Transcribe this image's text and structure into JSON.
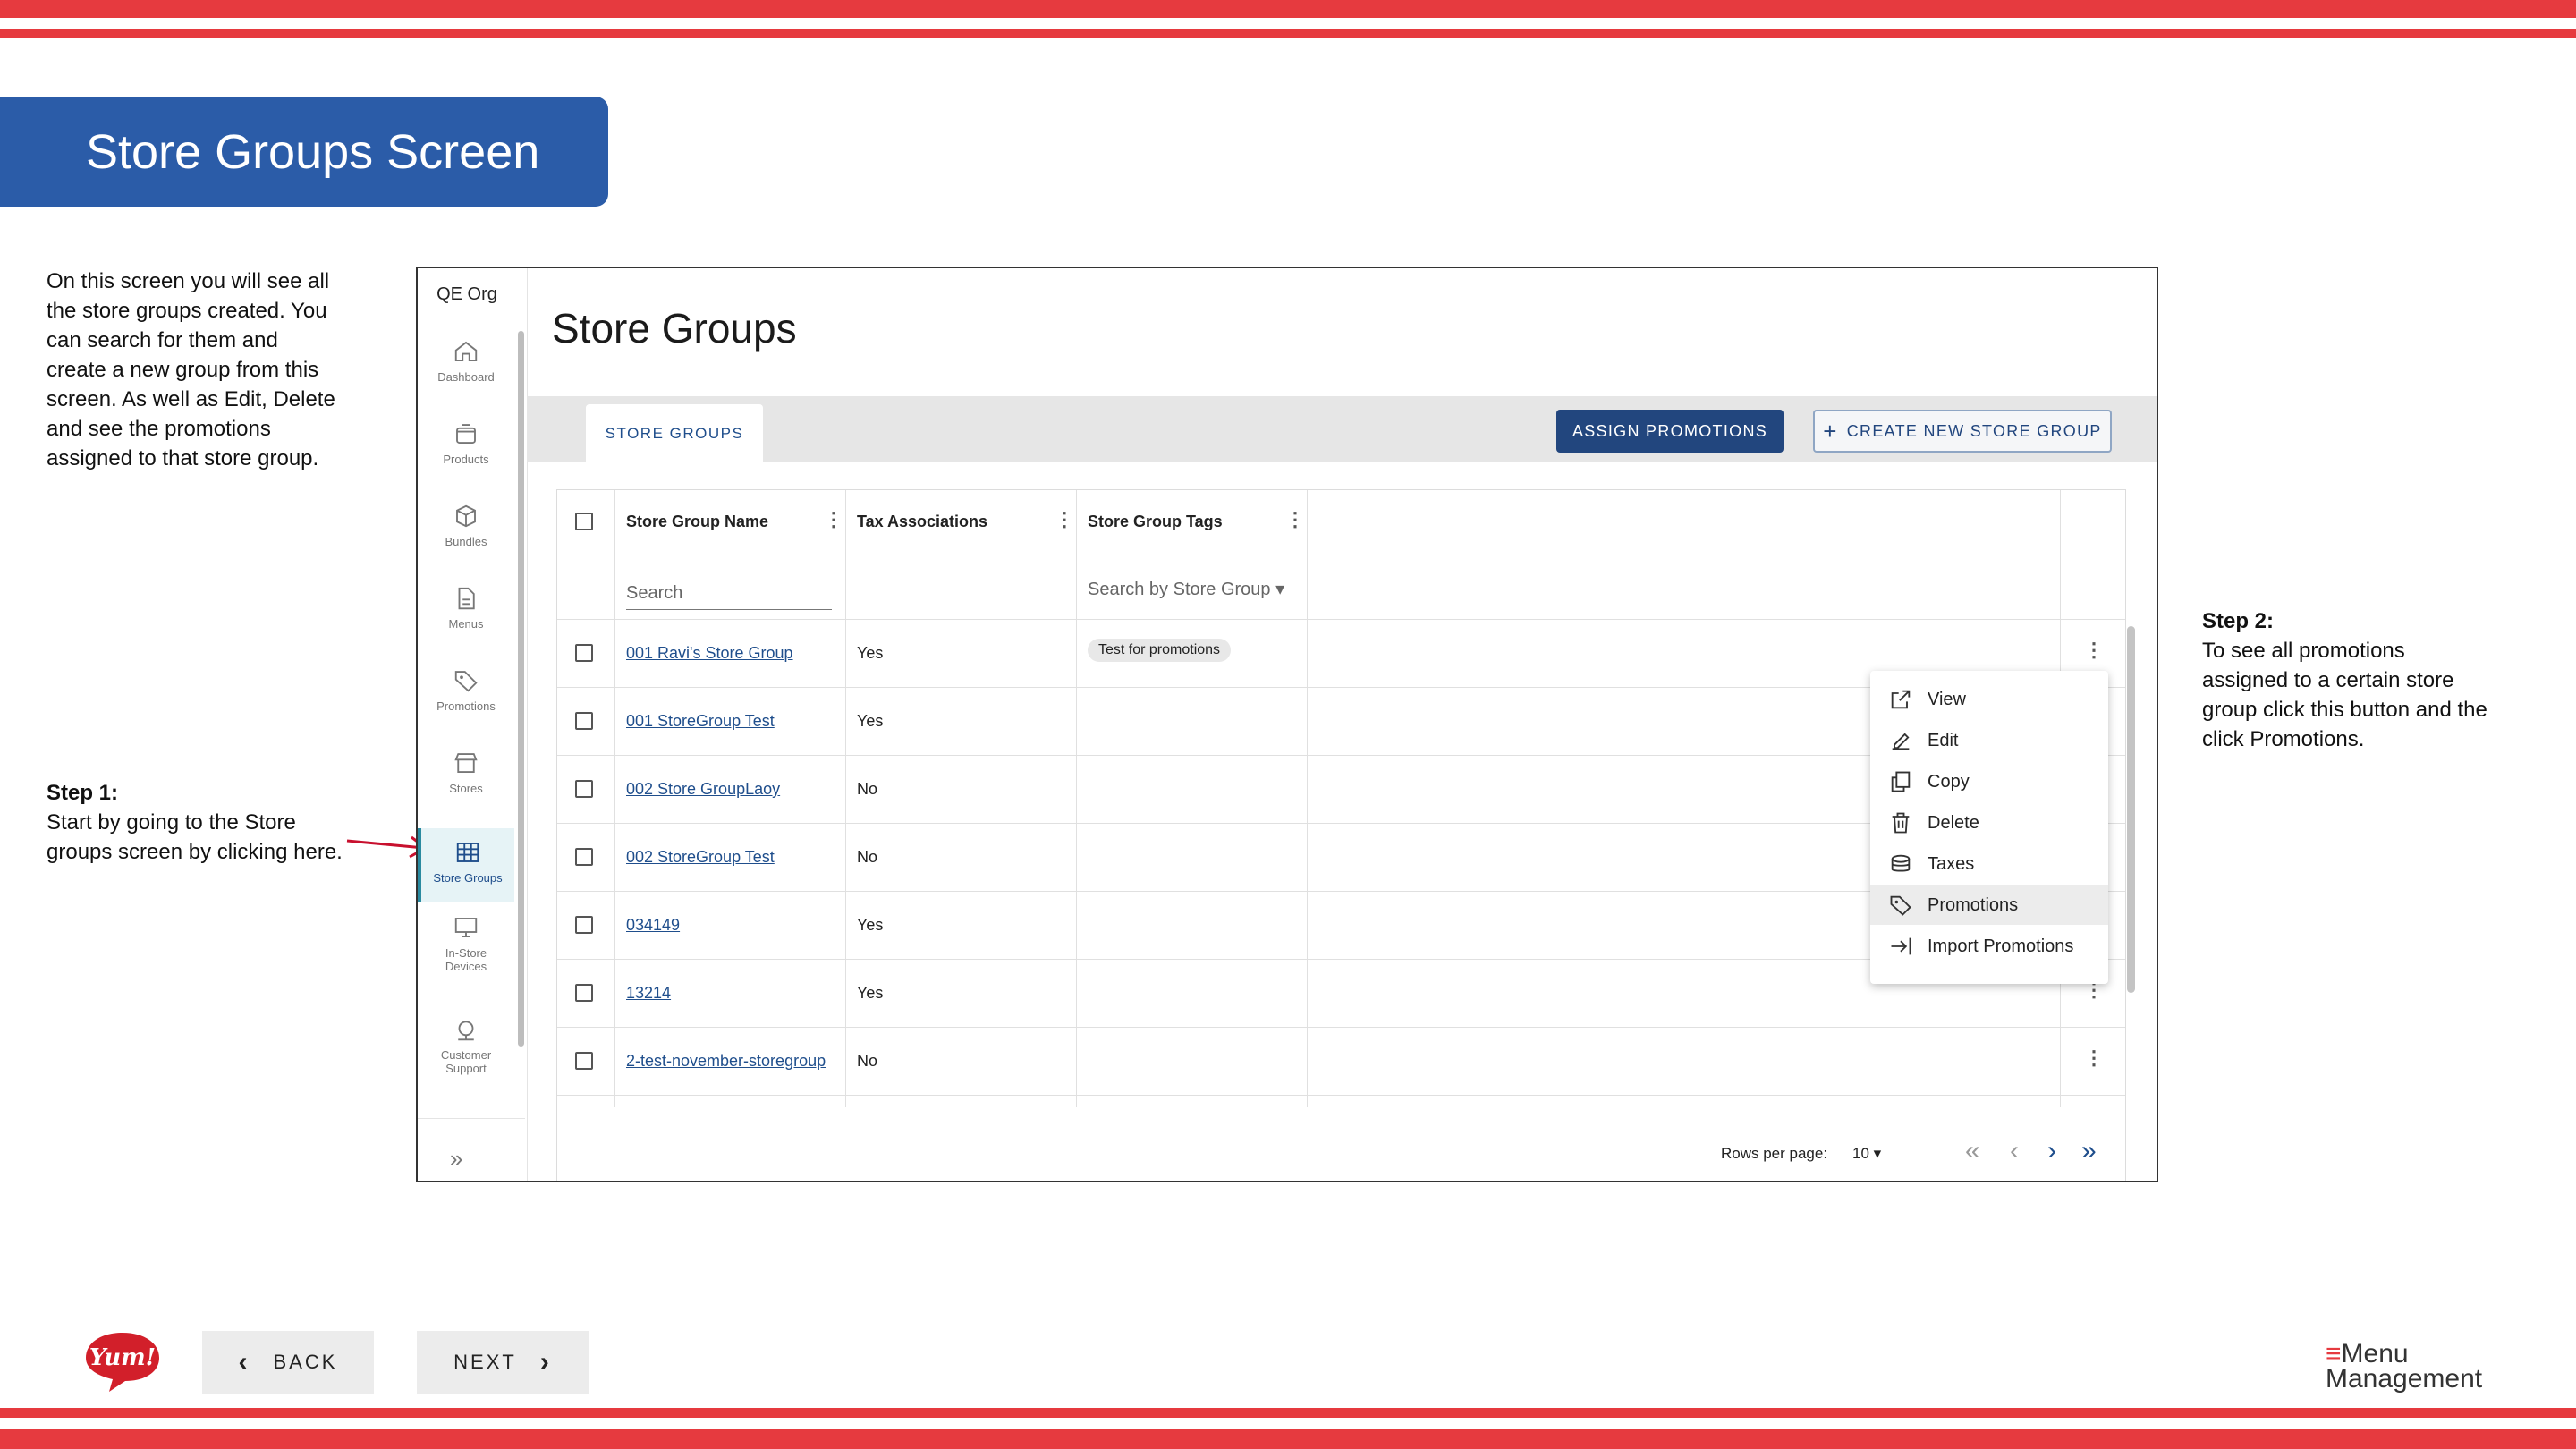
{
  "slide": {
    "title": "Store Groups Screen",
    "intro": "On this screen you will see all the store groups created. You can search for them and create a new group from this screen. As well as Edit, Delete and see the promotions assigned to that store group.",
    "step1_heading": "Step 1:",
    "step1_text": "Start by going to the Store groups screen by clicking here.",
    "step2_heading": "Step 2:",
    "step2_text": "To see all promotions assigned to a certain store group click this button and the click Promotions.",
    "back_label": "BACK",
    "next_label": "NEXT",
    "logo_text": "Yum!",
    "brand_line1": "Menu",
    "brand_line2": "Management",
    "accent_color": "#e63a3f",
    "banner_color": "#2b5ca8"
  },
  "app": {
    "org": "QE Org",
    "nav": [
      {
        "label": "Dashboard",
        "icon": "home-icon"
      },
      {
        "label": "Products",
        "icon": "products-icon"
      },
      {
        "label": "Bundles",
        "icon": "cube-icon"
      },
      {
        "label": "Menus",
        "icon": "document-icon"
      },
      {
        "label": "Promotions",
        "icon": "tag-icon"
      },
      {
        "label": "Stores",
        "icon": "store-icon"
      },
      {
        "label": "Store Groups",
        "icon": "grid-icon"
      },
      {
        "label": "In-Store Devices",
        "icon": "monitor-icon"
      },
      {
        "label": "Customer Support",
        "icon": "support-icon"
      }
    ],
    "page_title": "Store Groups",
    "tab": "STORE GROUPS",
    "assign_button": "ASSIGN PROMOTIONS",
    "create_button": "CREATE NEW STORE GROUP",
    "columns": [
      "Store Group Name",
      "Tax Associations",
      "Store Group Tags"
    ],
    "search_placeholder": "Search",
    "tag_search_placeholder": "Search by Store Group",
    "rows": [
      {
        "name": "001 Ravi's Store Group",
        "tax": "Yes",
        "tag": "Test for promotions"
      },
      {
        "name": "001 StoreGroup Test",
        "tax": "Yes",
        "tag": ""
      },
      {
        "name": "002 Store GroupLaoy",
        "tax": "No",
        "tag": ""
      },
      {
        "name": "002 StoreGroup Test",
        "tax": "No",
        "tag": ""
      },
      {
        "name": "034149",
        "tax": "Yes",
        "tag": ""
      },
      {
        "name": "13214",
        "tax": "Yes",
        "tag": ""
      },
      {
        "name": "2-test-november-storegroup",
        "tax": "No",
        "tag": ""
      }
    ],
    "menu": [
      {
        "label": "View",
        "icon": "external-link-icon"
      },
      {
        "label": "Edit",
        "icon": "edit-icon"
      },
      {
        "label": "Copy",
        "icon": "copy-icon"
      },
      {
        "label": "Delete",
        "icon": "trash-icon"
      },
      {
        "label": "Taxes",
        "icon": "coins-icon"
      },
      {
        "label": "Promotions",
        "icon": "tag-icon"
      },
      {
        "label": "Import Promotions",
        "icon": "import-icon"
      }
    ],
    "rows_per_page_label": "Rows per page:",
    "rows_per_page_value": "10"
  }
}
